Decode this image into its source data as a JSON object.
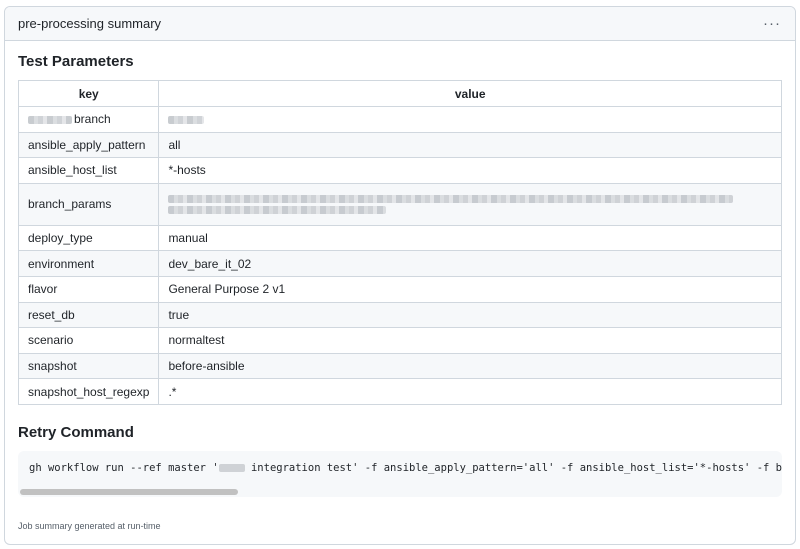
{
  "header": {
    "title": "pre-processing summary",
    "menu_label": "···"
  },
  "params": {
    "title": "Test Parameters",
    "columns": [
      "key",
      "value"
    ],
    "rows": [
      {
        "key": "branch",
        "value": ""
      },
      {
        "key": "ansible_apply_pattern",
        "value": "all"
      },
      {
        "key": "ansible_host_list",
        "value": "*-hosts"
      },
      {
        "key": "branch_params",
        "value": ""
      },
      {
        "key": "deploy_type",
        "value": "manual"
      },
      {
        "key": "environment",
        "value": "dev_bare_it_02"
      },
      {
        "key": "flavor",
        "value": "General Purpose 2 v1"
      },
      {
        "key": "reset_db",
        "value": "true"
      },
      {
        "key": "scenario",
        "value": "normaltest"
      },
      {
        "key": "snapshot",
        "value": "before-ansible"
      },
      {
        "key": "snapshot_host_regexp",
        "value": ".*"
      }
    ]
  },
  "retry": {
    "title": "Retry Command",
    "cmd_prefix": "gh workflow run --ref master '",
    "cmd_suffix": " integration test' -f ansible_apply_pattern='all' -f ansible_host_list='*-hosts' -f branch_params='"
  },
  "footer": {
    "text": "Job summary generated at run-time"
  }
}
